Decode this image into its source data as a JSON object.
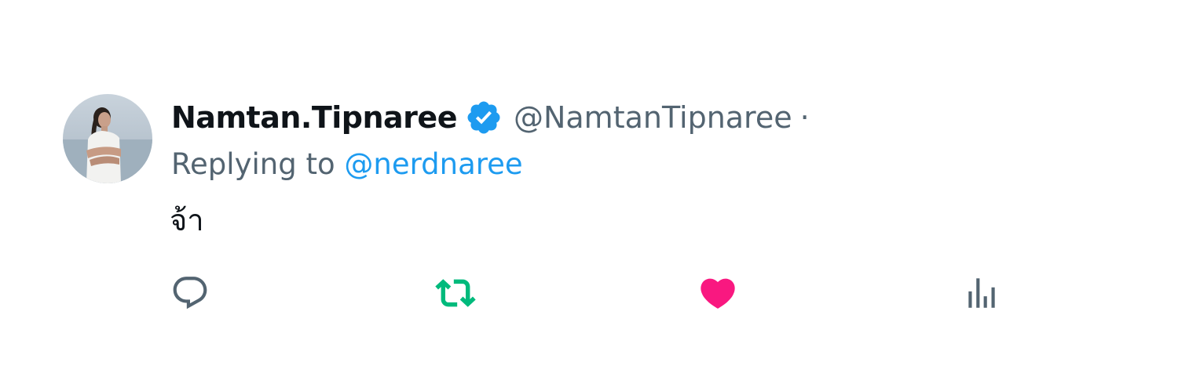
{
  "tweet": {
    "author": {
      "display_name": "Namtan.Tipnaree",
      "handle": "@NamtanTipnaree",
      "separator": "·",
      "verified": true,
      "avatar_icon": "profile-photo"
    },
    "reply_context": {
      "prefix": "Replying to",
      "mention": "@nerdnaree"
    },
    "text": "จ้า",
    "actions": {
      "reply": {
        "icon": "reply-bubble-icon",
        "active": false
      },
      "retweet": {
        "icon": "retweet-icon",
        "active": true,
        "color": "#00ba7c"
      },
      "like": {
        "icon": "heart-icon",
        "active": true,
        "color": "#f91880"
      },
      "views": {
        "icon": "analytics-bars-icon",
        "active": false
      }
    }
  },
  "colors": {
    "text_primary": "#0f1419",
    "text_secondary": "#536471",
    "accent": "#1d9bf0",
    "verified": "#1d9bf0"
  }
}
